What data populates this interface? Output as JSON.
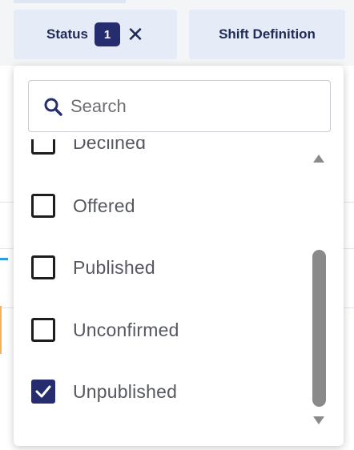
{
  "filters": {
    "status": {
      "label": "Status",
      "count": "1",
      "clear_glyph": "✕"
    },
    "shift_definition": {
      "label": "Shift Definition"
    }
  },
  "dropdown": {
    "search": {
      "placeholder": "Search",
      "value": ""
    },
    "options": [
      {
        "label": "Declined",
        "checked": false
      },
      {
        "label": "Offered",
        "checked": false
      },
      {
        "label": "Published",
        "checked": false
      },
      {
        "label": "Unconfirmed",
        "checked": false
      },
      {
        "label": "Unpublished",
        "checked": true
      }
    ]
  },
  "colors": {
    "accent": "#252d6e",
    "chip_background": "#e6ecf7",
    "chip_text": "#1f2a56",
    "scroll_thumb": "#8a8a8a"
  },
  "icons": {
    "search": "search-icon",
    "clear": "close-icon",
    "check": "checkmark-icon",
    "scroll_up": "triangle-up-icon",
    "scroll_down": "triangle-down-icon"
  }
}
